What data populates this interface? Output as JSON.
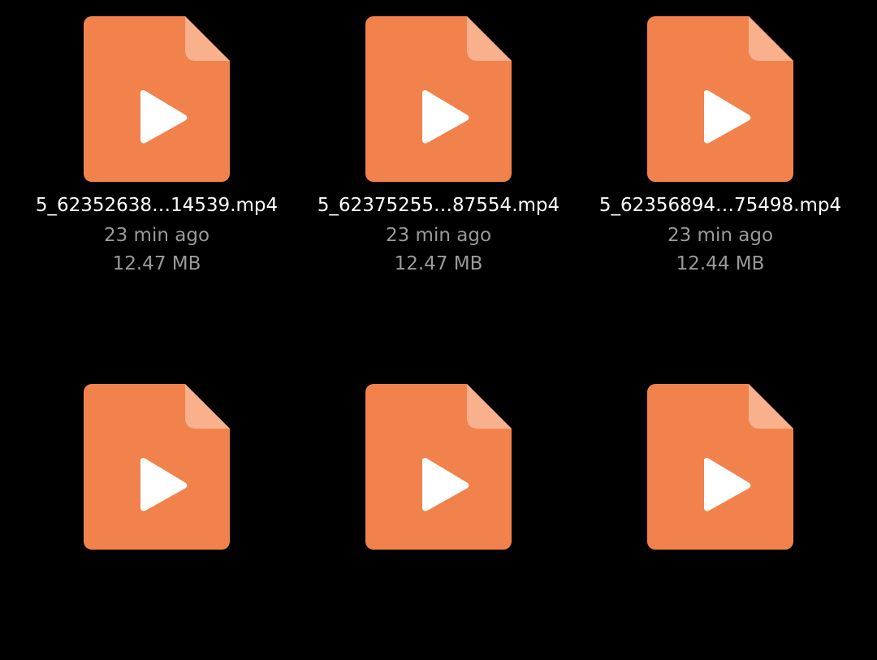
{
  "colors": {
    "background": "#000000",
    "file_icon_body": "#F2824C",
    "file_icon_fold": "#F9B08C",
    "play_glyph": "#FFFFFF",
    "name_text": "#FFFFFF",
    "meta_text": "#9A9A9A"
  },
  "icon": "video-file-icon",
  "files": [
    {
      "name": "5_62352638…14539.mp4",
      "time": "23 min ago",
      "size": "12.47 MB"
    },
    {
      "name": "5_62375255…87554.mp4",
      "time": "23 min ago",
      "size": "12.47 MB"
    },
    {
      "name": "5_62356894…75498.mp4",
      "time": "23 min ago",
      "size": "12.44 MB"
    },
    {
      "name": "",
      "time": "",
      "size": ""
    },
    {
      "name": "",
      "time": "",
      "size": ""
    },
    {
      "name": "",
      "time": "",
      "size": ""
    }
  ]
}
